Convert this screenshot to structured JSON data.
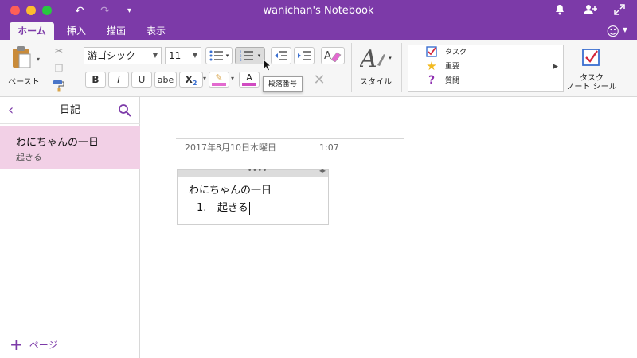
{
  "window": {
    "title": "wanichan's Notebook"
  },
  "ribbon_tabs": [
    {
      "label": "ホーム",
      "active": true
    },
    {
      "label": "挿入",
      "active": false
    },
    {
      "label": "描画",
      "active": false
    },
    {
      "label": "表示",
      "active": false
    }
  ],
  "ribbon": {
    "paste_label": "ペースト",
    "font_name": "游ゴシック",
    "font_size": "11",
    "bold": "B",
    "italic": "I",
    "underline": "U",
    "strikethrough": "abe",
    "subscript": "X",
    "subscript_index": "2",
    "style_label": "スタイル",
    "tags": [
      {
        "label": "タスク",
        "icon": "checkbox-icon"
      },
      {
        "label": "重要",
        "icon": "star-icon"
      },
      {
        "label": "質問",
        "icon": "question-icon"
      }
    ],
    "task_tag_label_line1": "タスク",
    "task_tag_label_line2": "ノート シール",
    "tooltip": "段落番号"
  },
  "sidebar": {
    "section_title": "日記",
    "pages": [
      {
        "title": "わにちゃんの一日",
        "preview": "起きる"
      }
    ],
    "add_page_label": "ページ"
  },
  "page": {
    "date": "2017年8月10日木曜日",
    "time": "1:07",
    "note_title": "わにちゃんの一日",
    "list_items": [
      {
        "number": "1.",
        "text": "起きる"
      }
    ]
  },
  "colors": {
    "brand": "#7c3aa8",
    "selected_page": "#f2d0e6",
    "highlight_swatch": "#e36ad0",
    "font_color_swatch": "#d14bc2"
  }
}
